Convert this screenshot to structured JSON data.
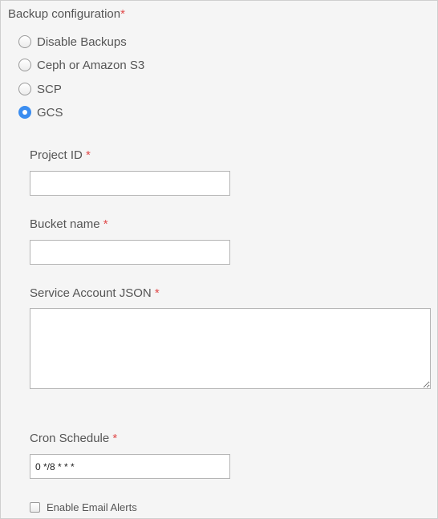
{
  "backup_config": {
    "title": "Backup configuration",
    "required_marker": "*",
    "options": [
      {
        "label": "Disable Backups",
        "selected": false
      },
      {
        "label": "Ceph or Amazon S3",
        "selected": false
      },
      {
        "label": "SCP",
        "selected": false
      },
      {
        "label": "GCS",
        "selected": true
      }
    ]
  },
  "fields": {
    "project_id": {
      "label": "Project ID",
      "required_marker": "*",
      "value": ""
    },
    "bucket_name": {
      "label": "Bucket name",
      "required_marker": "*",
      "value": ""
    },
    "service_account_json": {
      "label": "Service Account JSON",
      "required_marker": "*",
      "value": ""
    },
    "cron_schedule": {
      "label": "Cron Schedule",
      "required_marker": "*",
      "value": "0 */8 * * *"
    }
  },
  "email_alerts": {
    "label": "Enable Email Alerts",
    "checked": false
  },
  "colors": {
    "accent": "#3b8df0",
    "required": "#e04a4a",
    "background": "#f5f5f5"
  }
}
